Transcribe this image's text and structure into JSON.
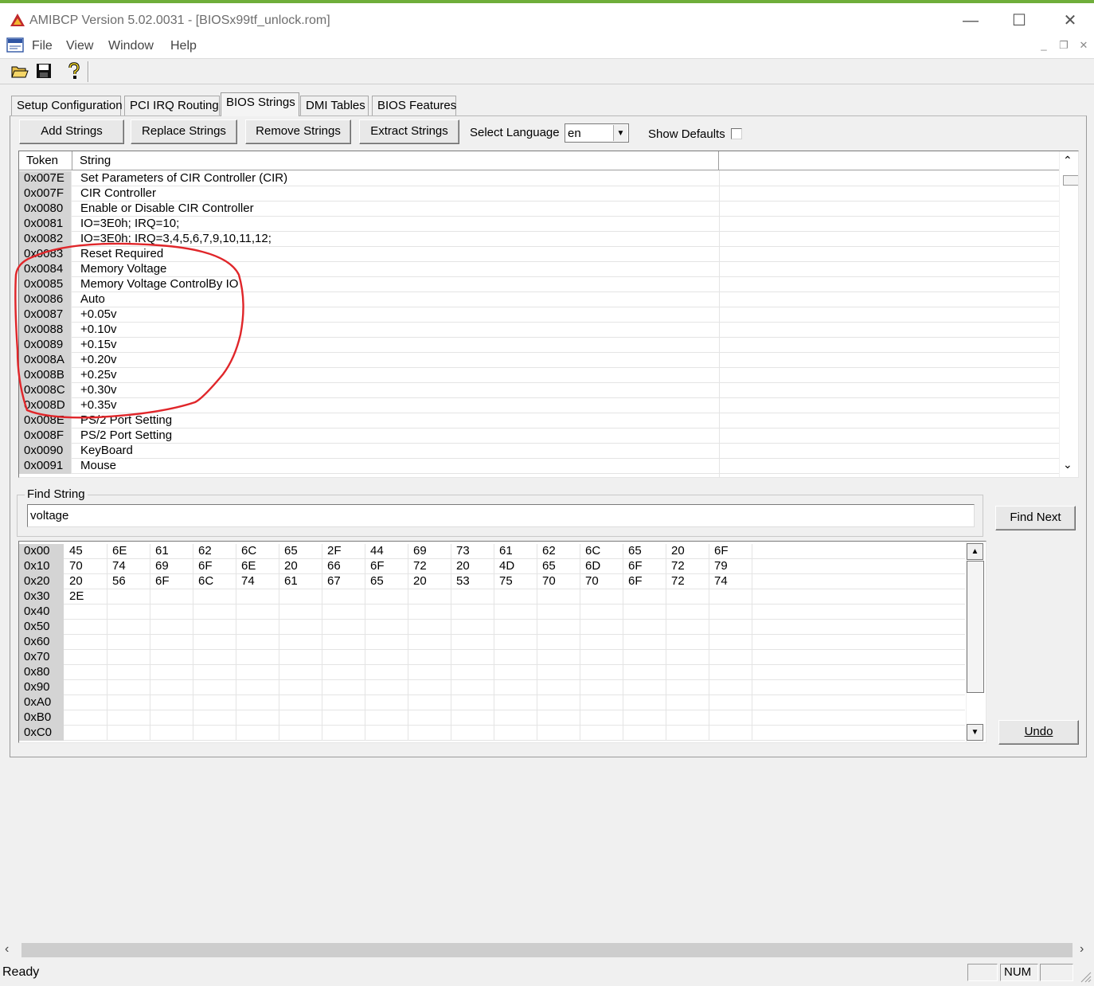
{
  "window": {
    "title": "AMIBCP Version 5.02.0031 - [BIOSx99tf_unlock.rom]",
    "icon": "amibcp-app-icon",
    "controls": {
      "minimize": "—",
      "maximize": "☐",
      "close": "✕"
    }
  },
  "menubar": {
    "icon": "rom-document-icon",
    "items": [
      "File",
      "View",
      "Window",
      "Help"
    ],
    "mdi_controls": {
      "minimize": "_",
      "restore": "❐",
      "close": "✕"
    }
  },
  "toolbar": {
    "buttons": [
      {
        "icon": "open-folder-icon"
      },
      {
        "icon": "save-disk-icon"
      },
      {
        "icon": "help-question-icon"
      }
    ]
  },
  "tabs": [
    "Setup Configuration",
    "PCI IRQ Routing",
    "BIOS Strings",
    "DMI Tables",
    "BIOS Features"
  ],
  "active_tab": "BIOS Strings",
  "actions": {
    "add": "Add Strings",
    "replace": "Replace Strings",
    "remove": "Remove Strings",
    "extract": "Extract Strings"
  },
  "language": {
    "label": "Select Language",
    "value": "en"
  },
  "show_defaults": {
    "label": "Show Defaults",
    "checked": false
  },
  "strings_table": {
    "headers": [
      "Token",
      "String"
    ],
    "rows": [
      {
        "token": "0x007E",
        "string": "Set Parameters of CIR Controller (CIR)"
      },
      {
        "token": "0x007F",
        "string": "CIR Controller"
      },
      {
        "token": "0x0080",
        "string": "Enable or Disable CIR Controller"
      },
      {
        "token": "0x0081",
        "string": "IO=3E0h; IRQ=10;"
      },
      {
        "token": "0x0082",
        "string": "IO=3E0h; IRQ=3,4,5,6,7,9,10,11,12;"
      },
      {
        "token": "0x0083",
        "string": "Reset Required"
      },
      {
        "token": "0x0084",
        "string": "Memory Voltage"
      },
      {
        "token": "0x0085",
        "string": "Memory Voltage ControlBy IO"
      },
      {
        "token": "0x0086",
        "string": "Auto"
      },
      {
        "token": "0x0087",
        "string": "+0.05v"
      },
      {
        "token": "0x0088",
        "string": "+0.10v"
      },
      {
        "token": "0x0089",
        "string": "+0.15v"
      },
      {
        "token": "0x008A",
        "string": "+0.20v"
      },
      {
        "token": "0x008B",
        "string": "+0.25v"
      },
      {
        "token": "0x008C",
        "string": "+0.30v"
      },
      {
        "token": "0x008D",
        "string": "+0.35v"
      },
      {
        "token": "0x008E",
        "string": "PS/2 Port Setting"
      },
      {
        "token": "0x008F",
        "string": "PS/2 Port Setting"
      },
      {
        "token": "0x0090",
        "string": "KeyBoard"
      },
      {
        "token": "0x0091",
        "string": "Mouse"
      }
    ]
  },
  "find": {
    "legend": "Find String",
    "value": "voltage",
    "button": "Find Next"
  },
  "hex_view": {
    "rows": [
      {
        "addr": "0x00",
        "bytes": [
          "45",
          "6E",
          "61",
          "62",
          "6C",
          "65",
          "2F",
          "44",
          "69",
          "73",
          "61",
          "62",
          "6C",
          "65",
          "20",
          "6F"
        ]
      },
      {
        "addr": "0x10",
        "bytes": [
          "70",
          "74",
          "69",
          "6F",
          "6E",
          "20",
          "66",
          "6F",
          "72",
          "20",
          "4D",
          "65",
          "6D",
          "6F",
          "72",
          "79"
        ]
      },
      {
        "addr": "0x20",
        "bytes": [
          "20",
          "56",
          "6F",
          "6C",
          "74",
          "61",
          "67",
          "65",
          "20",
          "53",
          "75",
          "70",
          "70",
          "6F",
          "72",
          "74"
        ]
      },
      {
        "addr": "0x30",
        "bytes": [
          "2E"
        ]
      },
      {
        "addr": "0x40",
        "bytes": []
      },
      {
        "addr": "0x50",
        "bytes": []
      },
      {
        "addr": "0x60",
        "bytes": []
      },
      {
        "addr": "0x70",
        "bytes": []
      },
      {
        "addr": "0x80",
        "bytes": []
      },
      {
        "addr": "0x90",
        "bytes": []
      },
      {
        "addr": "0xA0",
        "bytes": []
      },
      {
        "addr": "0xB0",
        "bytes": []
      },
      {
        "addr": "0xC0",
        "bytes": []
      }
    ],
    "undo_button": "Undo"
  },
  "status": {
    "text": "Ready",
    "num": "NUM"
  },
  "annotation_color": "#e0262a"
}
